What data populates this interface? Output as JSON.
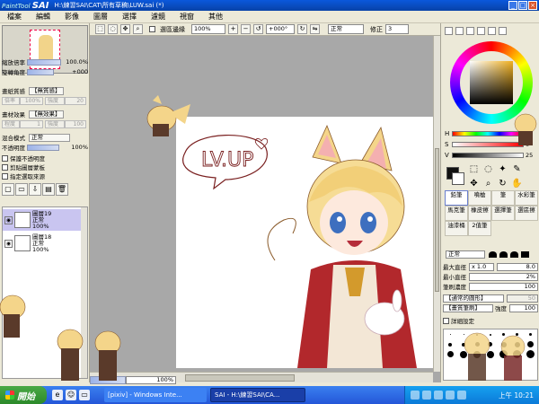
{
  "window": {
    "app_logo_small": "PaintTool",
    "app_logo_big": "SAI",
    "title": "H:\\練習SAI\\CAT\\所有草稿\\LUW.sai (*)"
  },
  "menu": [
    "檔案",
    "編輯",
    "影像",
    "圖層",
    "選擇",
    "濾鏡",
    "視窗",
    "其他"
  ],
  "left_panel": {
    "zoom_label": "縮放倍率",
    "zoom_value": "100.0%",
    "rotate_label": "旋轉角度",
    "rotate_value": "+000",
    "paper_texture_label": "畫紙質感",
    "paper_texture_value": "【無質感】",
    "scale_label": "倍率",
    "scale_value": "100%",
    "strength_label": "強度",
    "strength_value": "20",
    "effect_label": "畫材效果",
    "effect_value": "【無效果】",
    "width_label": "程度",
    "width_value": "1",
    "effect_strength_label": "強度",
    "effect_strength_value": "100",
    "blend_label": "混合模式",
    "blend_value": "正常",
    "opacity_label": "不透明度",
    "opacity_value": "100%",
    "checkboxes": [
      "保護不透明度",
      "剪貼圖層蒙板",
      "指定選取來源"
    ],
    "layers": [
      {
        "name": "圖層19",
        "mode": "正常",
        "opacity": "100%"
      },
      {
        "name": "圖層18",
        "mode": "正常",
        "opacity": "100%"
      }
    ]
  },
  "canvas_toolbar": {
    "select_edges_label": "選區邊緣",
    "zoom_value": "100%",
    "angle_value": "+000°",
    "blend_value": "正常",
    "stabilizer_label": "修正",
    "stabilizer_value": "3"
  },
  "canvas": {
    "zoom_footer": "100%",
    "speech_text": "LV.UP"
  },
  "right_panel": {
    "h_label": "H",
    "h_value": "0",
    "s_label": "S",
    "s_value": "0",
    "v_label": "V",
    "v_value": "25",
    "tools": [
      {
        "label": "鉛筆",
        "selected": true
      },
      {
        "label": "噴槍",
        "selected": false
      },
      {
        "label": "筆",
        "selected": false
      },
      {
        "label": "水彩筆",
        "selected": false
      },
      {
        "label": "馬克筆",
        "selected": false
      },
      {
        "label": "橡皮擦",
        "selected": false
      },
      {
        "label": "選擇筆",
        "selected": false
      },
      {
        "label": "選區擦",
        "selected": false
      },
      {
        "label": "油漆桶",
        "selected": false
      },
      {
        "label": "2值筆",
        "selected": false
      }
    ],
    "shape_label": "正常",
    "max_size_label": "最大直徑",
    "max_size_mult": "x 1.0",
    "max_size_value": "8.0",
    "min_size_label": "最小直徑",
    "min_size_value": "2%",
    "density_label": "筆刷濃度",
    "density_value": "100",
    "brush_shape": "【通常的圓形】",
    "brush_shape_value": "50",
    "brush_texture": "【畫質筆刷】",
    "brush_texture_strength_label": "強度",
    "brush_texture_strength": "100",
    "detail_label": "詳細設定"
  },
  "taskbar": {
    "start_label": "開始",
    "tasks": [
      "[pixiv] - Windows Inte...",
      "SAI - H:\\練習SAI\\CA..."
    ],
    "clock": "上午 10:21"
  }
}
